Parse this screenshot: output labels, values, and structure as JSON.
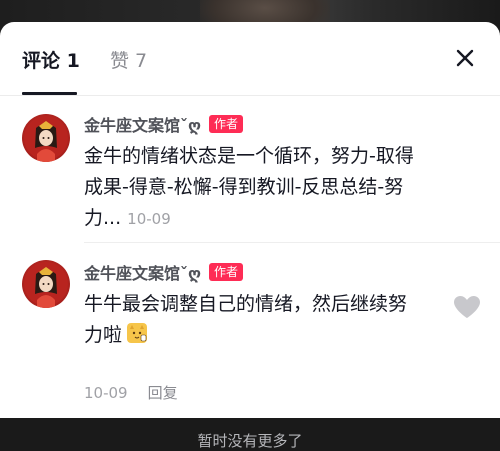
{
  "tabs": {
    "comments_label": "评论 1",
    "likes_label": "赞 7"
  },
  "comments": [
    {
      "username": "金牛座文案馆ˇღ",
      "badge": "作者",
      "text": "金牛的情绪状态是一个循环，努力-取得成果-得意-松懈-得到教训-反思总结-努力...",
      "time": "10-09"
    },
    {
      "username": "金牛座文案馆ˇღ",
      "badge": "作者",
      "text": "牛牛最会调整自己的情绪，然后继续努力啦",
      "emoji": "cat-thumbs-up-emoji",
      "time": "10-09",
      "reply_label": "回复"
    }
  ],
  "footer": {
    "hint": "暂时没有更多了"
  },
  "icons": {
    "close": "close-icon",
    "like": "heart-icon"
  },
  "colors": {
    "badge": "#fe2c55",
    "text_primary": "#161823",
    "text_secondary": "#a0a1a6"
  }
}
